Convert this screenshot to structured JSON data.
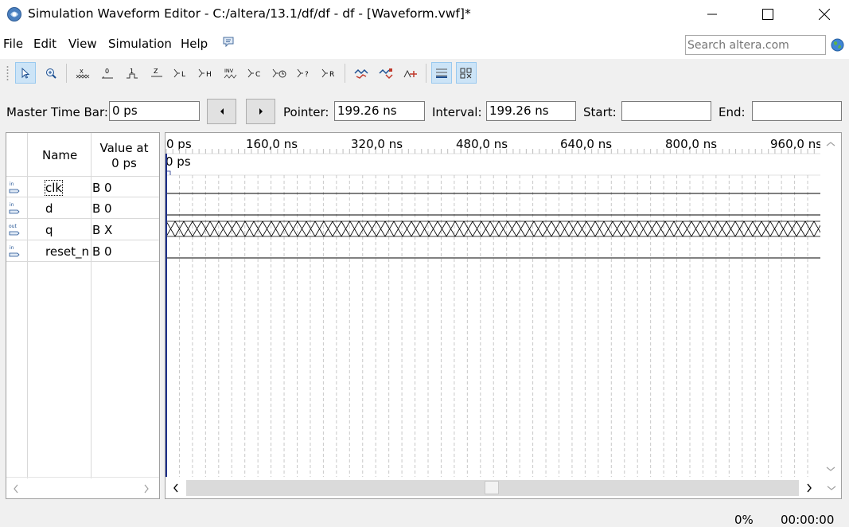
{
  "window": {
    "title": "Simulation Waveform Editor - C:/altera/13.1/df/df - df - [Waveform.vwf]*"
  },
  "menu": {
    "items": [
      "File",
      "Edit",
      "View",
      "Simulation",
      "Help"
    ],
    "search_placeholder": "Search altera.com"
  },
  "toolbar": {
    "buttons": [
      "select-tool",
      "zoom-tool",
      "uninitialized-x",
      "forcing-low-0",
      "forcing-high-1",
      "high-impedance-z",
      "weak-low-l",
      "weak-high-h",
      "invert-inv",
      "count-value-c",
      "forcing-clock",
      "arbitrary-value",
      "random-value-r",
      "snap-to-grid",
      "insert-signal",
      "overwrite-clock",
      "show-grid",
      "group-bus"
    ]
  },
  "timebar": {
    "master_label": "Master Time Bar:",
    "master_value": "0 ps",
    "pointer_label": "Pointer:",
    "pointer_value": "199.26 ns",
    "interval_label": "Interval:",
    "interval_value": "199.26 ns",
    "start_label": "Start:",
    "start_value": "",
    "end_label": "End:",
    "end_value": ""
  },
  "signals": {
    "header_name": "Name",
    "header_value_line1": "Value at",
    "header_value_line2": "0 ps",
    "rows": [
      {
        "direction": "in",
        "name": "clk",
        "value": "B 0",
        "wave": "low"
      },
      {
        "direction": "in",
        "name": "d",
        "value": "B 0",
        "wave": "low"
      },
      {
        "direction": "out",
        "name": "q",
        "value": "B X",
        "wave": "unknown"
      },
      {
        "direction": "in",
        "name": "reset_n",
        "value": "B 0",
        "wave": "low"
      }
    ]
  },
  "waveform": {
    "ticks": [
      "0 ps",
      "160,0 ns",
      "320,0 ns",
      "480,0 ns",
      "640,0 ns",
      "800,0 ns",
      "960,0 ns"
    ],
    "cursor_label": "0 ps"
  },
  "status": {
    "progress": "0%",
    "elapsed": "00:00:00"
  }
}
